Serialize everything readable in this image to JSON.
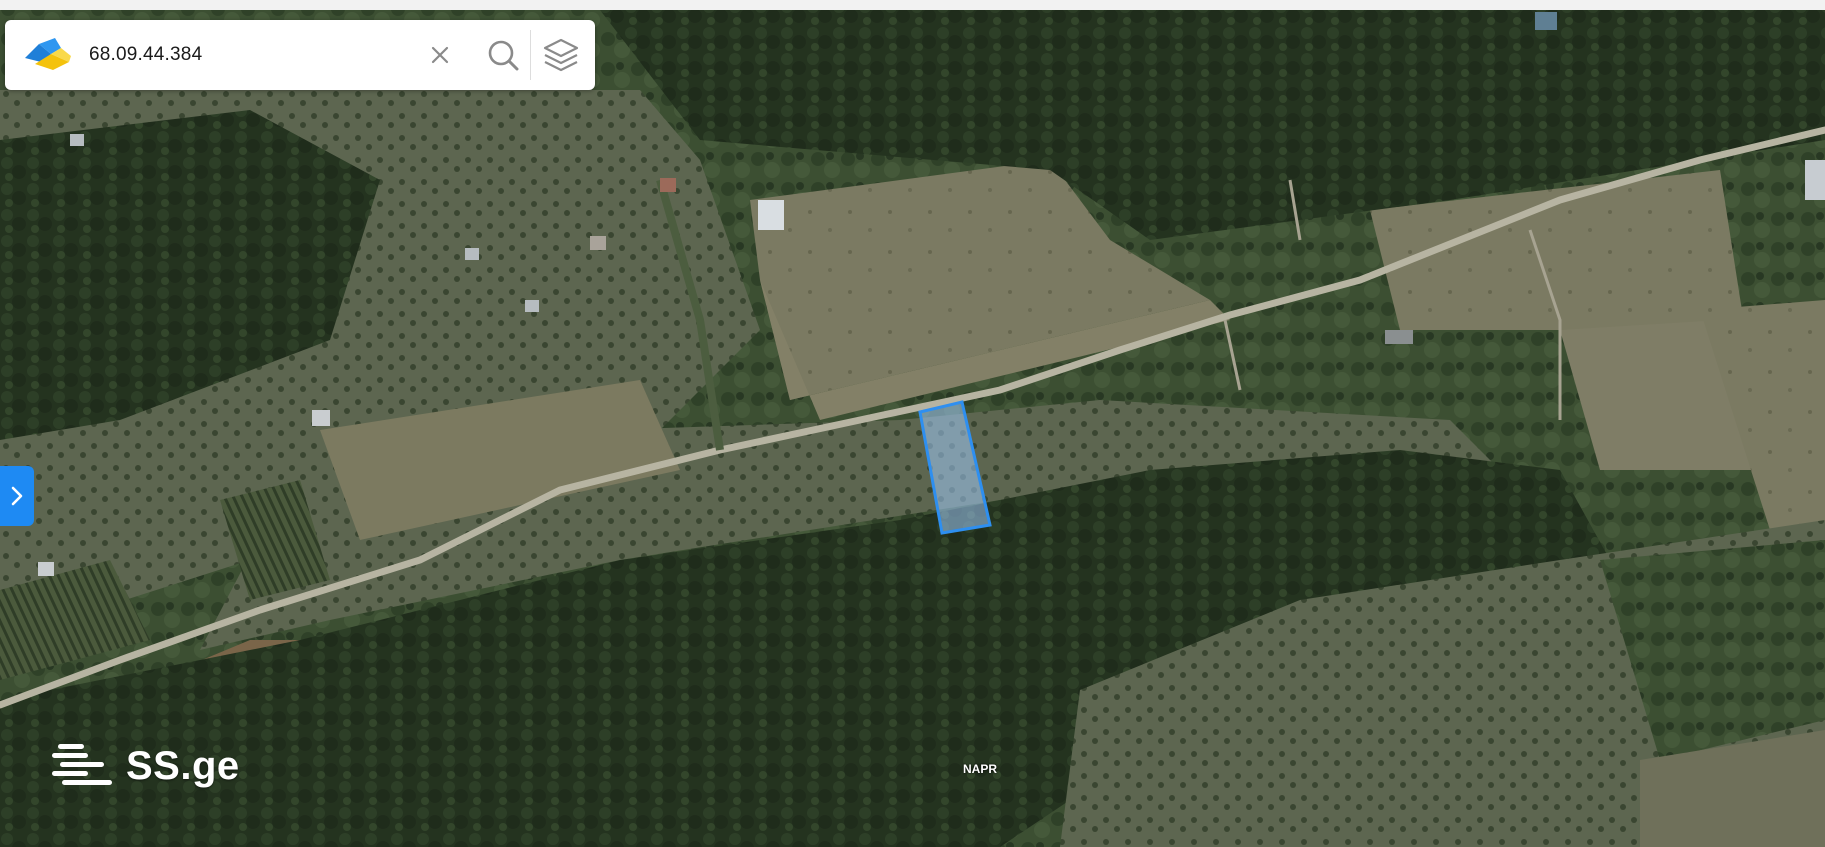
{
  "search": {
    "value": "68.09.44.384"
  },
  "icons": {
    "logo": "napr-logo",
    "clear": "close-icon",
    "search": "search-icon",
    "layers": "layers-icon",
    "side_toggle": "chevron-right-icon"
  },
  "colors": {
    "accent": "#1e8af3",
    "parcel_fill": "#9ec9f5",
    "parcel_stroke": "#2e8ff0"
  },
  "brand": {
    "text": "SS.ge"
  },
  "attribution": {
    "text": "NAPR"
  }
}
